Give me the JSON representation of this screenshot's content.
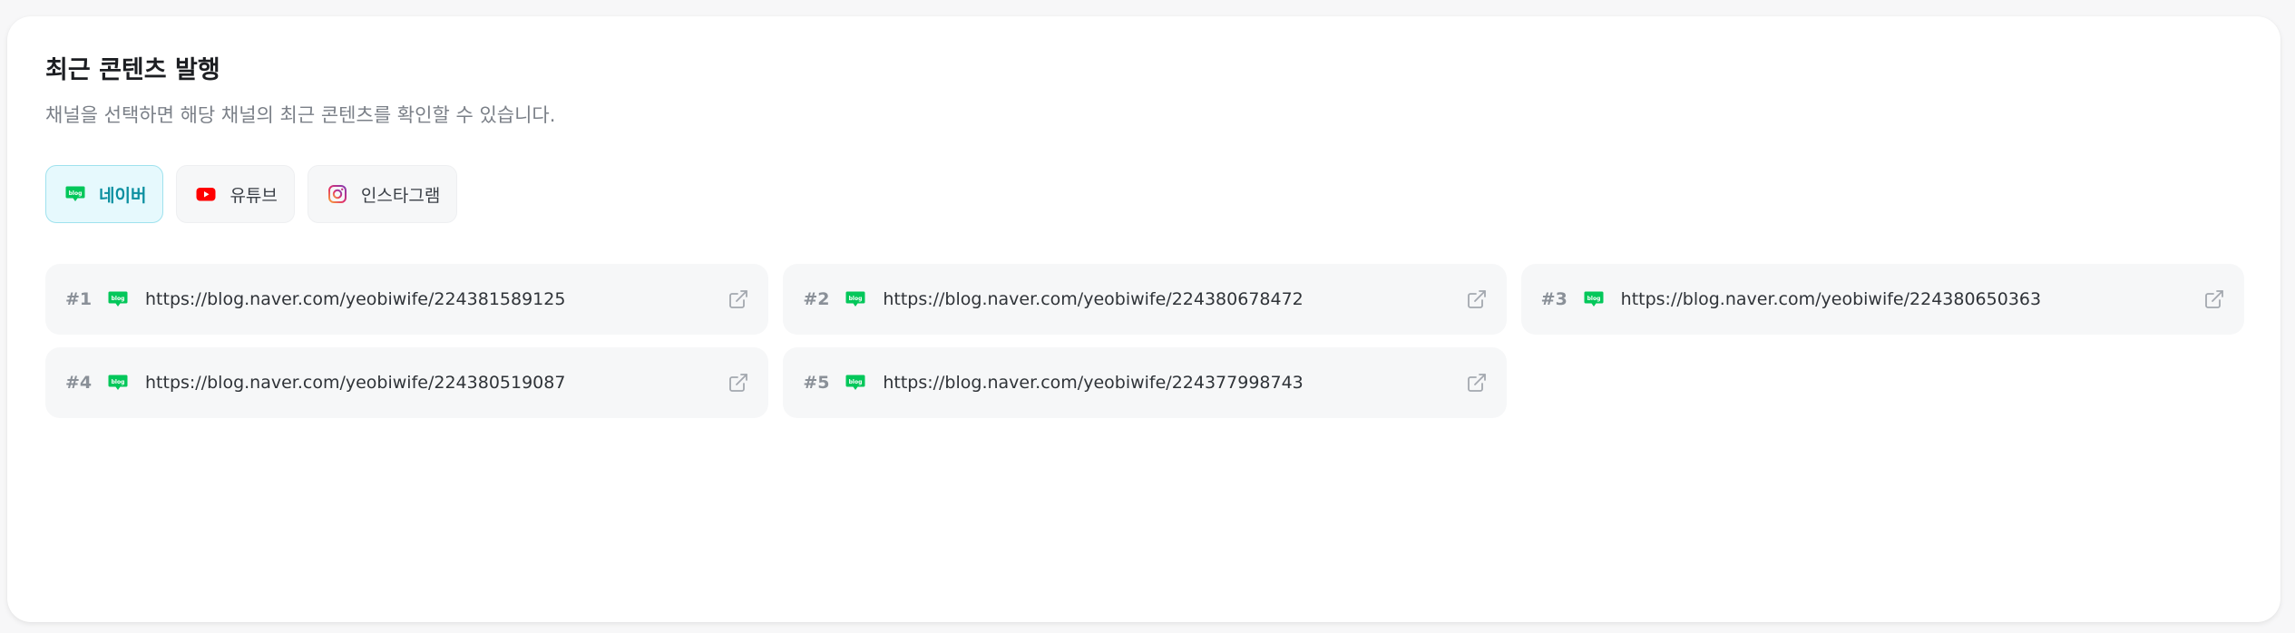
{
  "section": {
    "title": "최근 콘텐츠 발행",
    "subtitle": "채널을 선택하면 해당 채널의 최근 콘텐츠를 확인할 수 있습니다."
  },
  "tabs": [
    {
      "label": "네이버",
      "icon": "naver-blog-icon",
      "active": true
    },
    {
      "label": "유튜브",
      "icon": "youtube-icon",
      "active": false
    },
    {
      "label": "인스타그램",
      "icon": "instagram-icon",
      "active": false
    }
  ],
  "contents": [
    {
      "index": "#1",
      "url": "https://blog.naver.com/yeobiwife/224381589125"
    },
    {
      "index": "#2",
      "url": "https://blog.naver.com/yeobiwife/224380678472"
    },
    {
      "index": "#3",
      "url": "https://blog.naver.com/yeobiwife/224380650363"
    },
    {
      "index": "#4",
      "url": "https://blog.naver.com/yeobiwife/224380519087"
    },
    {
      "index": "#5",
      "url": "https://blog.naver.com/yeobiwife/224377998743"
    }
  ],
  "icons": {
    "naver_blog_badge": "blog"
  },
  "colors": {
    "naver_green": "#03c75a",
    "youtube_red": "#ff0000",
    "active_tab_bg": "#e6f9fd",
    "active_tab_text": "#0b8fa0"
  }
}
